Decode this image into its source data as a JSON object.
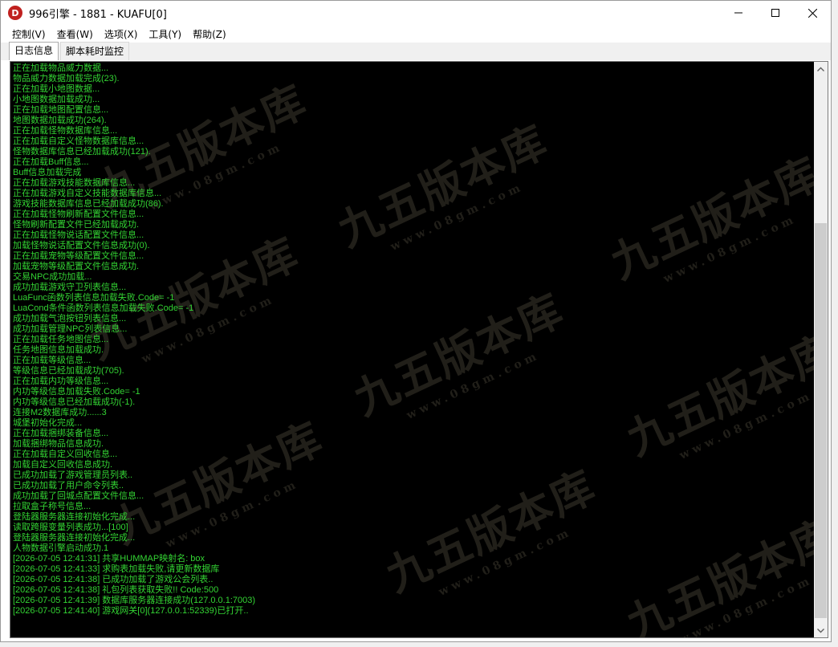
{
  "window": {
    "title": "996引擎 - 1881 - KUAFU[0]",
    "icon_letter": "D",
    "controls": [
      "minimize-icon",
      "maximize-icon",
      "close-icon"
    ]
  },
  "menu": {
    "items": [
      "控制(V)",
      "查看(W)",
      "选项(X)",
      "工具(Y)",
      "帮助(Z)"
    ]
  },
  "tabs": [
    {
      "label": "日志信息",
      "active": true
    },
    {
      "label": "脚本耗时监控",
      "active": false
    }
  ],
  "watermark": {
    "big": "九五版本库",
    "small": "www.08gm.com"
  },
  "log": {
    "text_color": "#33d433",
    "background": "#000000",
    "lines": [
      "正在加载物品威力数据...",
      "物品威力数据加载完成(23).",
      "正在加载小地图数据...",
      "小地图数据加载成功...",
      "正在加载地图配置信息...",
      "地图数据加载成功(264).",
      "正在加载怪物数据库信息...",
      "正在加载自定义怪物数据库信息...",
      "怪物数据库信息已经加载成功(121).",
      "正在加载Buff信息...",
      "Buff信息加载完成",
      "正在加载游戏技能数据库信息...",
      "正在加载游戏自定义技能数据库信息...",
      "游戏技能数据库信息已经加载成功(86).",
      "正在加载怪物刷新配置文件信息...",
      "怪物刷新配置文件已经加载成功.",
      "正在加载怪物说话配置文件信息...",
      "加载怪物说话配置文件信息成功(0).",
      "正在加载宠物等级配置文件信息...",
      "加载宠物等级配置文件信息成功.",
      "交易NPC成功加载...",
      "成功加载游戏守卫列表信息...",
      "LuaFunc函数列表信息加载失败.Code= -1",
      "LuaCond条件函数列表信息加载失败.Code= -1",
      "成功加载气泡按钮列表信息...",
      "成功加载管理NPC列表信息...",
      "正在加载任务地图信息...",
      "任务地图信息加载成功.",
      "正在加载等级信息...",
      "等级信息已经加载成功(705).",
      "正在加载内功等级信息...",
      "内功等级信息加载失败.Code= -1",
      "内功等级信息已经加载成功(-1).",
      "连接M2数据库成功......3",
      "城堡初始化完成...",
      "正在加载捆绑装备信息...",
      "加载捆绑物品信息成功.",
      "正在加载自定义回收信息...",
      "加载自定义回收信息成功.",
      "已成功加载了游戏管理员列表..",
      "已成功加载了用户命令列表..",
      "成功加载了回城点配置文件信息...",
      "拉取盒子称号信息...",
      "登陆器服务器连接初始化完成...",
      "读取跨服变量列表成功...[100]",
      "登陆器服务器连接初始化完成...",
      "人物数据引擎启动成功.1",
      "[2026-07-05 12:41:31] 共享HUMMAP映射名: box",
      "[2026-07-05 12:41:33] 求购表加载失败,请更新数据库",
      "[2026-07-05 12:41:38] 已成功加载了游戏公会列表..",
      "[2026-07-05 12:41:38] 礼包列表获取失败!! Code:500",
      "[2026-07-05 12:41:39] 数据库服务器连接成功(127.0.0.1:7003)",
      "[2026-07-05 12:41:40] 游戏网关[0](127.0.0.1:52339)已打开.."
    ]
  },
  "scrollbar": {
    "thumb_position_fraction": 0.27,
    "thumb_size_fraction": 0.72
  }
}
